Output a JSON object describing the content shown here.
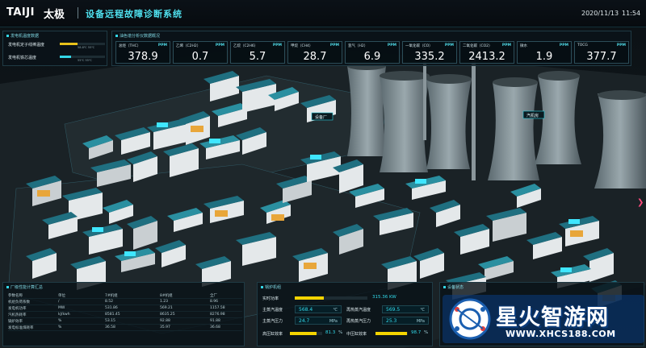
{
  "header": {
    "logo_en": "TAIJI",
    "logo_cn": "太极",
    "title": "设备远程故障诊断系统",
    "date": "2020/11/13",
    "time": "11:54"
  },
  "temp_panel": {
    "title": "发电机温度数据",
    "rows": [
      {
        "label": "发电机定子线棒温度",
        "fill": 0.4,
        "color": "#e8c21a",
        "ticks": "58.8℃    55℃"
      },
      {
        "label": "发电机铁芯温度",
        "fill": 0.25,
        "color": "#33d6e6",
        "ticks": "55℃    55℃"
      }
    ]
  },
  "gas_panel": {
    "title": "油色谱分析仪数据概况",
    "cards": [
      {
        "name": "总烃（THC）",
        "unit": "PPM",
        "value": "378.9"
      },
      {
        "name": "乙烯（C2H2）",
        "unit": "PPM",
        "value": "0.7"
      },
      {
        "name": "乙烷（C2H6）",
        "unit": "PPM",
        "value": "5.7"
      },
      {
        "name": "甲烷（CH4）",
        "unit": "PPM",
        "value": "28.7"
      },
      {
        "name": "氢气（H2）",
        "unit": "PPM",
        "value": "6.9"
      },
      {
        "name": "一氧化碳（CO）",
        "unit": "PPM",
        "value": "335.2"
      },
      {
        "name": "二氧化碳（CO2）",
        "unit": "PPM",
        "value": "2413.2"
      },
      {
        "name": "微水",
        "unit": "PPM",
        "value": "1.9"
      },
      {
        "name": "TOCG",
        "unit": "PPM",
        "value": "377.7"
      }
    ]
  },
  "table_panel": {
    "title": "厂级性能计算汇总",
    "headers": [
      "参数名称",
      "单位",
      "7#机组",
      "8#机组",
      "全厂"
    ],
    "rows": [
      [
        "机组负荷系数",
        "/",
        "8.52",
        "1.23",
        "8.96"
      ],
      [
        "发电机功率",
        "MW",
        "531.86",
        "569.21",
        "1157.58"
      ],
      [
        "汽机热耗率",
        "kJ/kwh",
        "8581.45",
        "8635.25",
        "8276.98"
      ],
      [
        "锅炉效率",
        "%",
        "53.15",
        "92.88",
        "91.88"
      ],
      [
        "发电标准煤耗率",
        "%",
        "36.58",
        "35.97",
        "36.68"
      ]
    ]
  },
  "boiler_panel": {
    "title": "锅炉机组",
    "power_label": "实时功率",
    "power_value": "315.36 KW",
    "power_fill": 0.4,
    "rows": [
      {
        "l1": "主蒸汽温度",
        "v1": "568.4",
        "u1": "℃",
        "l2": "再热蒸汽温度",
        "v2": "569.5",
        "u2": "℃"
      },
      {
        "l1": "主蒸汽压力",
        "v1": "24.7",
        "u1": "MPa",
        "l2": "再热蒸汽压力",
        "v2": "25.3",
        "u2": "MPa"
      }
    ],
    "valves": [
      {
        "label": "高压缸效率",
        "pct": "81.3",
        "fill": 0.813,
        "suffix": "%"
      },
      {
        "label": "中压缸效率",
        "pct": "98.7",
        "fill": 0.987,
        "suffix": "%"
      }
    ]
  },
  "br_panel": {
    "title": "设备状态"
  },
  "watermark": {
    "text": "星火智游网",
    "url": "WWW.XHCS188.COM"
  },
  "scene": {
    "tags": [
      {
        "label": "设备厂"
      },
      {
        "label": "汽机房"
      }
    ]
  }
}
